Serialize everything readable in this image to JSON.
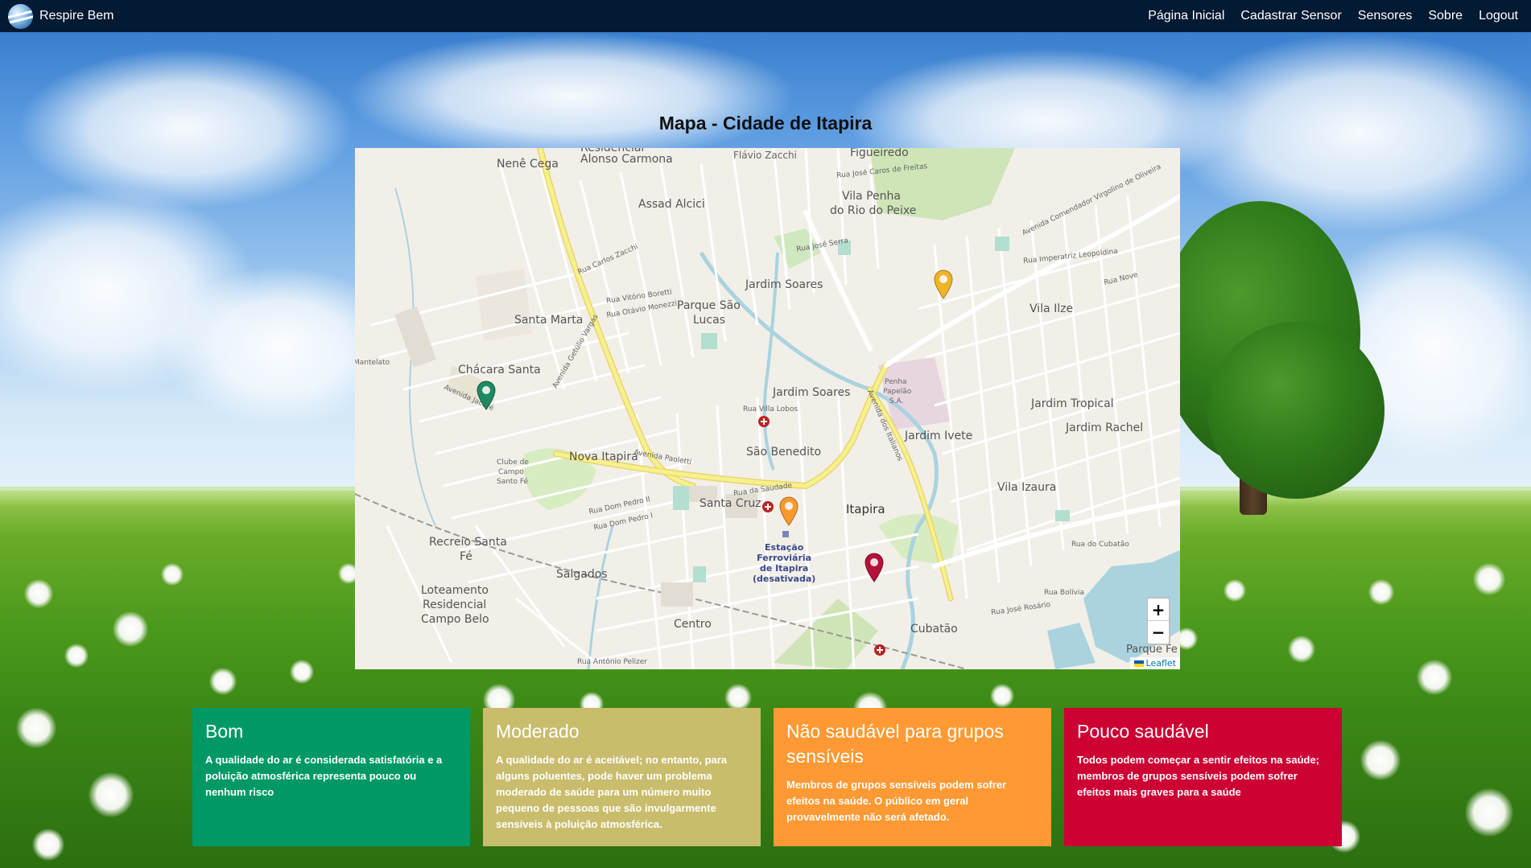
{
  "navbar": {
    "brand": "Respire Bem",
    "links": [
      "Página Inicial",
      "Cadastrar Sensor",
      "Sensores",
      "Sobre",
      "Logout"
    ]
  },
  "page": {
    "title": "Mapa - Cidade de Itapira"
  },
  "map": {
    "labels": {
      "alonso_carmona": "Alonso Carmona",
      "nene_cega": "Nenê Cega",
      "residencial": "Residencial",
      "flavio_zacchi": "Flávio Zacchi",
      "figueiredo": "Figueiredo",
      "assad_alcici": "Assad Alcici",
      "vila_penha": "Vila Penha",
      "do_rio_do_peixe": "do Rio do Peixe",
      "jardim_soares_n": "Jardim Soares",
      "parque_sao": "Parque São",
      "lucas": "Lucas",
      "santa_marta": "Santa Marta",
      "vila_ilze": "Vila Ilze",
      "chacara_santa": "Chácara Santa",
      "jardim_soares": "Jardim Soares",
      "jardim_tropical": "Jardim Tropical",
      "jardim_rachel": "Jardim Rachel",
      "jardim_ivete": "Jardim Ivete",
      "penha": "Penha",
      "papeldo": "Papelão",
      "sa": "S.A.",
      "nova_itapira": "Nova Itapira",
      "sao_benedito": "São Benedito",
      "clube_de": "Clube de",
      "campo": "Campo",
      "santo_fe": "Santo Fé",
      "santa_cruz": "Santa Cruz",
      "itapira": "Itapira",
      "vila_izaura": "Vila Izaura",
      "recreio_santa": "Recreio Santa",
      "fe": "Fé",
      "salgados": "Salgados",
      "loteamento": "Loteamento",
      "residencial2": "Residencial",
      "campo_belo": "Campo Belo",
      "centro": "Centro",
      "cubatao": "Cubatão",
      "parque_fe": "Parque Fe",
      "estacao": "Estação",
      "ferroviaria": "Ferroviária",
      "de_itapira": "de Itapira",
      "desativada": "(desativada)",
      "av_getulio": "Avenida Getúlio Vargas",
      "av_paoletti": "Avenida Paoletti",
      "av_italianos": "Avenida dos Italianos",
      "av_comendador": "Avenida Comendador Virgolino de Oliveira",
      "rua_do_cubatao": "Rua do Cubatão",
      "rua_jose_serra": "Rua José Serra",
      "rua_bolivia": "Rua Bolívia",
      "rua_jose_rosario": "Rua José Rosário",
      "rua_antonio_pelizer": "Rua Antônio Pelizer",
      "mantelato": "Mantelato",
      "rua_imperatriz": "Rua Imperatriz Leopoldina",
      "rua_nove": "Rua Nove",
      "avenida_jacare": "Avenida Jacaré",
      "rua_dom_pedro_ii": "Rua Dom Pedro II",
      "rua_dom_pedro_i": "Rua Dom Pedro I",
      "rua_da_saudade": "Rua da Saudade",
      "rua_villa_lobos": "Rua Villa Lobos",
      "rua_jose_caros": "Rua José Caros de Freitas",
      "rua_carlos_zacchi": "Rua Carlos Zacchi",
      "rua_vitorio_boretti": "Rua Vitório Boretti",
      "rua_otavio_monezzi": "Rua Otávio Monezzi"
    },
    "zoom_in": "+",
    "zoom_out": "−",
    "attribution": "Leaflet"
  },
  "legend": [
    {
      "title": "Bom",
      "text": "A qualidade do ar é considerada satisfatória e a poluição atmosférica representa pouco ou nenhum risco",
      "color": "#009966"
    },
    {
      "title": "Moderado",
      "text": "A qualidade do ar é aceitável; no entanto, para alguns poluentes, pode haver um problema moderado de saúde para um número muito pequeno de pessoas que são invulgarmente sensíveis à poluição atmosférica.",
      "color": "#c9bc6c"
    },
    {
      "title": "Não saudável para grupos sensíveis",
      "text": "Membros de grupos sensíveis podem sofrer efeitos na saúde. O público em geral provavelmente não será afetado.",
      "color": "#ff9933"
    },
    {
      "title": "Pouco saudável",
      "text": "Todos podem começar a sentir efeitos na saúde; membros de grupos sensíveis podem sofrer efeitos mais graves para a saúde",
      "color": "#cc0033"
    }
  ],
  "markers": [
    {
      "name": "marker-green",
      "color": "#1f8a62"
    },
    {
      "name": "marker-yellow",
      "color": "#f0b428"
    },
    {
      "name": "marker-orange",
      "color": "#f79a2e"
    },
    {
      "name": "marker-red",
      "color": "#b5123a"
    }
  ]
}
